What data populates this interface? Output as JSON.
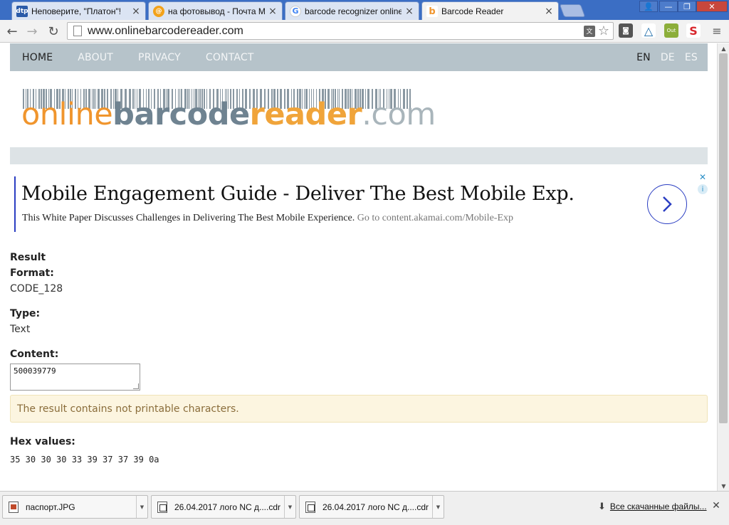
{
  "browser": {
    "tabs": [
      {
        "title": "Неповерите, \"Платон\"!",
        "favicon": "dtp",
        "favicon_color": "#2a5aa8"
      },
      {
        "title": "на фотовывод - Почта Mail",
        "favicon": "mail-icon",
        "favicon_color": "#f2a21b"
      },
      {
        "title": "barcode recognizer online - Г",
        "favicon": "google-icon",
        "favicon_color": "#4285f4"
      },
      {
        "title": "Barcode Reader",
        "favicon": "barcode-reader-icon",
        "favicon_color": "#f0952d"
      }
    ],
    "active_tab": 3,
    "url": "www.onlinebarcodereader.com"
  },
  "site": {
    "nav": {
      "items": [
        "HOME",
        "ABOUT",
        "PRIVACY",
        "CONTACT"
      ],
      "active": "HOME",
      "languages": [
        "EN",
        "DE",
        "ES"
      ],
      "active_language": "EN"
    },
    "logo": {
      "part1": "online",
      "part2": "barcode",
      "part3": "reader",
      "part4": ".com"
    }
  },
  "ad": {
    "headline": "Mobile Engagement Guide - Deliver The Best Mobile Exp.",
    "description": "This White Paper Discusses Challenges in Delivering The Best Mobile Experience.",
    "link_text": "Go to content.akamai.com/Mobile-Exp"
  },
  "result": {
    "heading": "Result",
    "format_label": "Format:",
    "format_value": "CODE_128",
    "type_label": "Type:",
    "type_value": "Text",
    "content_label": "Content:",
    "content_value": "500039779",
    "warning": "The result contains not printable characters.",
    "hex_label": "Hex values:",
    "hex_values": "35 30 30 30 33 39 37 37 39 0a"
  },
  "downloads": {
    "items": [
      {
        "name": "паспорт.JPG",
        "type": "image"
      },
      {
        "name": "26.04.2017 лого NC д....cdr",
        "type": "cdr"
      },
      {
        "name": "26.04.2017 лого NC д....cdr",
        "type": "cdr"
      }
    ],
    "show_all": "Все скачанные файлы..."
  },
  "colors": {
    "nav_bg": "#b6c3ca",
    "accent_orange": "#f0952d",
    "accent_slate": "#6f8391",
    "ad_blue": "#2b3ec2",
    "warning_bg": "#fcf5e0"
  }
}
